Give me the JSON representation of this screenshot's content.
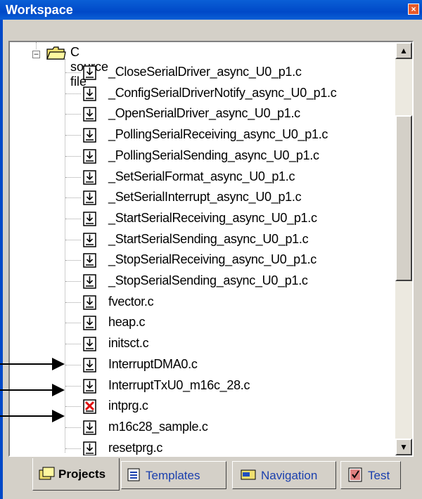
{
  "window": {
    "title": "Workspace",
    "close_glyph": "×"
  },
  "tree": {
    "folder_label": "C source file",
    "files": [
      {
        "name": "_CloseSerialDriver_async_U0_p1.c",
        "icon": "source-file-icon"
      },
      {
        "name": "_ConfigSerialDriverNotify_async_U0_p1.c",
        "icon": "source-file-icon"
      },
      {
        "name": "_OpenSerialDriver_async_U0_p1.c",
        "icon": "source-file-icon"
      },
      {
        "name": "_PollingSerialReceiving_async_U0_p1.c",
        "icon": "source-file-icon"
      },
      {
        "name": "_PollingSerialSending_async_U0_p1.c",
        "icon": "source-file-icon"
      },
      {
        "name": "_SetSerialFormat_async_U0_p1.c",
        "icon": "source-file-icon"
      },
      {
        "name": "_SetSerialInterrupt_async_U0_p1.c",
        "icon": "source-file-icon"
      },
      {
        "name": "_StartSerialReceiving_async_U0_p1.c",
        "icon": "source-file-icon"
      },
      {
        "name": "_StartSerialSending_async_U0_p1.c",
        "icon": "source-file-icon"
      },
      {
        "name": "_StopSerialReceiving_async_U0_p1.c",
        "icon": "source-file-icon"
      },
      {
        "name": "_StopSerialSending_async_U0_p1.c",
        "icon": "source-file-icon"
      },
      {
        "name": "fvector.c",
        "icon": "source-file-icon"
      },
      {
        "name": "heap.c",
        "icon": "source-file-icon"
      },
      {
        "name": "initsct.c",
        "icon": "source-file-icon"
      },
      {
        "name": "InterruptDMA0.c",
        "icon": "source-file-icon"
      },
      {
        "name": "InterruptTxU0_m16c_28.c",
        "icon": "source-file-icon"
      },
      {
        "name": "intprg.c",
        "icon": "excluded-file-icon"
      },
      {
        "name": "m16c28_sample.c",
        "icon": "source-file-icon"
      },
      {
        "name": "resetprg.c",
        "icon": "source-file-icon"
      }
    ]
  },
  "tabs": [
    {
      "label": "Projects",
      "icon": "projects-icon",
      "active": true
    },
    {
      "label": "Templates",
      "icon": "templates-icon",
      "active": false
    },
    {
      "label": "Navigation",
      "icon": "navigation-icon",
      "active": false
    },
    {
      "label": "Test",
      "icon": "test-icon",
      "active": false
    }
  ],
  "colors": {
    "titlebar": "#0a5fd6",
    "tab_text": "#1a3fae",
    "excluded_icon": "#e01010"
  }
}
